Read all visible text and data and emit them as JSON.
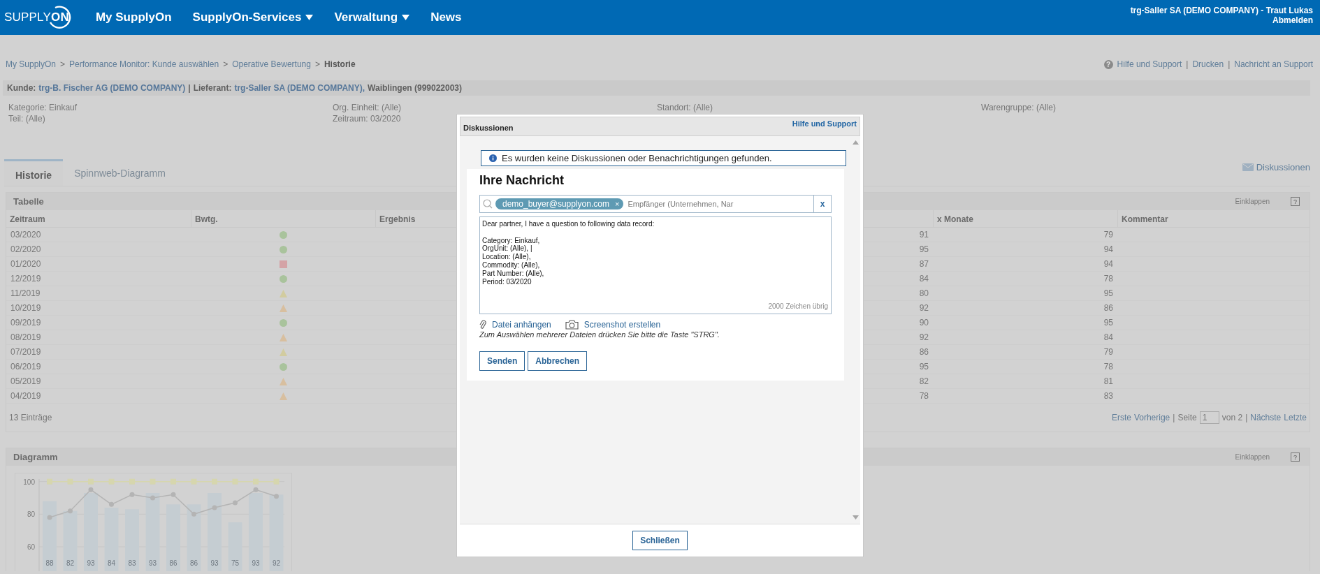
{
  "top_bar": {
    "logo": "SUPPLY**ON**",
    "nav": [
      {
        "label": "My SupplyOn",
        "dropdown": false
      },
      {
        "label": "SupplyOn-Services",
        "dropdown": true
      },
      {
        "label": "Verwaltung",
        "dropdown": true
      },
      {
        "label": "News",
        "dropdown": false
      }
    ],
    "user": "trg-Saller SA (DEMO COMPANY) - Traut Lukas",
    "logout": "Abmelden"
  },
  "breadcrumb": [
    {
      "kind": "link",
      "text": "My SupplyOn"
    },
    {
      "kind": "sep",
      "text": ">"
    },
    {
      "kind": "link",
      "text": "Performance Monitor: Kunde auswählen"
    },
    {
      "kind": "sep",
      "text": ">"
    },
    {
      "kind": "link",
      "text": "Operative Bewertung"
    },
    {
      "kind": "sep",
      "text": ">"
    },
    {
      "kind": "current",
      "text": "Historie"
    }
  ],
  "help_icon": "?",
  "help_links": [
    {
      "kind": "link",
      "text": "Hilfe und Support"
    },
    {
      "kind": "sep",
      "text": "|"
    },
    {
      "kind": "link",
      "text": "Drucken"
    },
    {
      "kind": "sep",
      "text": "|"
    },
    {
      "kind": "link",
      "text": "Nachricht an Support"
    }
  ],
  "partner_bar": [
    {
      "kind": "label",
      "text": "Kunde:"
    },
    {
      "kind": "link",
      "text": "trg-B. Fischer AG (DEMO COMPANY)"
    },
    {
      "kind": "label",
      "text": "|"
    },
    {
      "kind": "label",
      "text": "Lieferant:"
    },
    {
      "kind": "link",
      "text": "trg-Saller SA (DEMO COMPANY),"
    },
    {
      "kind": "label",
      "text": "Waiblingen (999022003)"
    }
  ],
  "filters": [
    [
      "Kategorie: Einkauf",
      "Teil: (Alle)"
    ],
    [
      "Org. Einheit: (Alle)",
      "Zeitraum: 03/2020"
    ],
    [
      "Standort: (Alle)"
    ],
    [
      "Warengruppe: (Alle)"
    ]
  ],
  "tabs": [
    {
      "label": "Historie",
      "selected": true
    },
    {
      "label": "Spinnweb-Diagramm",
      "selected": false
    }
  ],
  "discussions_link": "Diskussionen",
  "table": {
    "title": "Tabelle",
    "collapse": "Einklappen",
    "help": "?",
    "columns": [
      "Zeitraum",
      "Bwtg.",
      "Ergebnis",
      "x Monate",
      "Kommentar"
    ],
    "rows": [
      {
        "period": "03/2020",
        "rating": {
          "kind": "circle",
          "color": "#a9c39c"
        },
        "result": "91",
        "x_months": "79"
      },
      {
        "period": "02/2020",
        "rating": {
          "kind": "circle",
          "color": "#a9c39c"
        },
        "result": "95",
        "x_months": "94"
      },
      {
        "period": "01/2020",
        "rating": {
          "kind": "square",
          "color": "#d4a3a6"
        },
        "result": "87",
        "x_months": "94"
      },
      {
        "period": "12/2019",
        "rating": {
          "kind": "circle",
          "color": "#a9c39c"
        },
        "result": "84",
        "x_months": "78"
      },
      {
        "period": "11/2019",
        "rating": {
          "kind": "triangle",
          "color": "#d2cc9f"
        },
        "result": "80",
        "x_months": "95"
      },
      {
        "period": "10/2019",
        "rating": {
          "kind": "triangle",
          "color": "#d8bf9f"
        },
        "result": "92",
        "x_months": "86"
      },
      {
        "period": "09/2019",
        "rating": {
          "kind": "circle",
          "color": "#a9c39c"
        },
        "result": "90",
        "x_months": "95"
      },
      {
        "period": "08/2019",
        "rating": {
          "kind": "triangle",
          "color": "#d8bf9f"
        },
        "result": "92",
        "x_months": "84"
      },
      {
        "period": "07/2019",
        "rating": {
          "kind": "triangle",
          "color": "#d2cc9f"
        },
        "result": "86",
        "x_months": "79"
      },
      {
        "period": "06/2019",
        "rating": {
          "kind": "circle",
          "color": "#a9c39c"
        },
        "result": "95",
        "x_months": "78"
      },
      {
        "period": "05/2019",
        "rating": {
          "kind": "triangle",
          "color": "#d8bf9f"
        },
        "result": "82",
        "x_months": "81"
      },
      {
        "period": "04/2019",
        "rating": {
          "kind": "triangle",
          "color": "#d8bf9f"
        },
        "result": "78",
        "x_months": "83"
      }
    ],
    "count": "13 Einträge",
    "pagination": [
      {
        "kind": "link",
        "text": "Erste"
      },
      {
        "kind": "link",
        "text": "Vorherige"
      },
      {
        "kind": "sep",
        "text": "|"
      },
      {
        "kind": "text",
        "text": "Seite"
      },
      {
        "kind": "input",
        "text": "1"
      },
      {
        "kind": "text",
        "text": "von 2"
      },
      {
        "kind": "sep",
        "text": "|"
      },
      {
        "kind": "link",
        "text": "Nächste"
      },
      {
        "kind": "link",
        "text": "Letzte"
      }
    ]
  },
  "diagram": {
    "title": "Diagramm",
    "collapse": "Einklappen",
    "help": "?",
    "chart_data": {
      "type": "bar",
      "ylim": [
        45,
        105
      ],
      "yticks": [
        60,
        80,
        100
      ],
      "series": [
        {
          "type": "bar",
          "color": "#c5cdd2",
          "values": [
            88,
            82,
            93,
            84,
            83,
            93,
            86,
            86,
            93,
            75,
            93,
            92
          ],
          "value_labels": [
            "88",
            "82",
            "93",
            "84",
            "83",
            "93",
            "86",
            "86",
            "93",
            "75",
            "93",
            "92"
          ]
        },
        {
          "type": "line",
          "marker": "circle",
          "color": "#b4b4b4",
          "values": [
            78,
            82,
            95,
            86,
            92,
            90,
            92,
            80,
            84,
            87,
            95,
            91
          ]
        },
        {
          "type": "line",
          "marker": "square",
          "color": "#d6d6ae",
          "values": [
            100,
            100,
            100,
            100,
            100,
            100,
            100,
            100,
            100,
            100,
            100,
            100
          ]
        }
      ]
    }
  },
  "dialog": {
    "title": "Diskussionen",
    "help": "Hilfe und Support",
    "info": "Es wurden keine Diskussionen oder Benachrichtigungen gefunden.",
    "heading": "Ihre Nachricht",
    "recipient_chip": "demo_buyer@supplyon.com",
    "chip_remove": "×",
    "recipient_placeholder": "Empfänger (Unternehmen, Nar",
    "clear": "x",
    "message": "Dear partner, I have a question to following data record:\n\nCategory: Einkauf,\nOrgUnit: (Alle), |\nLocation: (Alle),\nCommodity: (Alle),\nPart Number: (Alle),\nPeriod: 03/2020",
    "counter": "2000 Zeichen übrig",
    "attach": "Datei anhängen",
    "screenshot": "Screenshot erstellen",
    "hint": "Zum Auswählen mehrerer Dateien drücken Sie bitte die Taste \"STRG\".",
    "buttons": [
      "Senden",
      "Abbrechen"
    ],
    "close": "Schließen"
  }
}
